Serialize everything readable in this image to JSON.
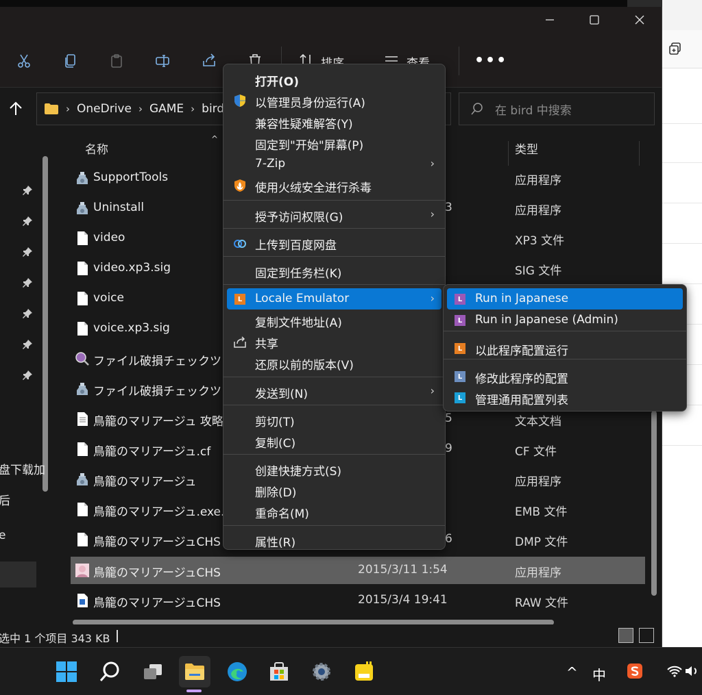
{
  "window": {
    "controls": {
      "minimize": "—",
      "maximize": "□",
      "close": "✕"
    }
  },
  "toolbar": {
    "sort_label": "排序",
    "view_label": "查看",
    "more_label": "•••"
  },
  "address": {
    "segments": [
      "OneDrive",
      "GAME",
      "bird"
    ],
    "search_placeholder": "在 bird 中搜索"
  },
  "columns": {
    "name": "名称",
    "type": "类型"
  },
  "nav": {
    "items": [
      "盘下载加",
      "后",
      "e"
    ]
  },
  "files": [
    {
      "name": "SupportTools",
      "date": "",
      "type": "应用程序",
      "icon": "setup-icon"
    },
    {
      "name": "Uninstall",
      "date": "3",
      "type": "应用程序",
      "icon": "setup-icon"
    },
    {
      "name": "video",
      "date": "",
      "type": "XP3 文件",
      "icon": "file-icon"
    },
    {
      "name": "video.xp3.sig",
      "date": "",
      "type": "SIG 文件",
      "icon": "file-icon"
    },
    {
      "name": "voice",
      "date": "",
      "type": "",
      "icon": "file-icon"
    },
    {
      "name": "voice.xp3.sig",
      "date": "",
      "type": "",
      "icon": "file-icon"
    },
    {
      "name": "ファイル破損チェックツ",
      "date": "",
      "type": "",
      "icon": "magnifier-icon"
    },
    {
      "name": "ファイル破損チェックツ",
      "date": "",
      "type": "",
      "icon": "setup-icon"
    },
    {
      "name": "鳥籠のマリアージュ 攻略",
      "date": "5",
      "type": "文本文档",
      "icon": "text-file-icon"
    },
    {
      "name": "鳥籠のマリアージュ.cf",
      "date": "9",
      "type": "CF 文件",
      "icon": "file-icon"
    },
    {
      "name": "鳥籠のマリアージュ",
      "date": "",
      "type": "应用程序",
      "icon": "setup-icon"
    },
    {
      "name": "鳥籠のマリアージュ.exe.",
      "date": "",
      "type": "EMB 文件",
      "icon": "file-icon"
    },
    {
      "name": "鳥籠のマリアージュCHS",
      "date": "6",
      "type": "DMP 文件",
      "icon": "file-icon"
    },
    {
      "name": "鳥籠のマリアージュCHS",
      "date": "2015/3/11 1:54",
      "type": "应用程序",
      "icon": "app-icon",
      "selected": true
    },
    {
      "name": "鳥籠のマリアージュCHS",
      "date": "2015/3/4 19:41",
      "type": "RAW 文件",
      "icon": "raw-file-icon"
    }
  ],
  "status": {
    "text": "选中 1 个项目  343 KB"
  },
  "context_menu": {
    "groups": [
      [
        {
          "label": "打开(O)",
          "bold": true,
          "icon": ""
        },
        {
          "label": "以管理员身份运行(A)",
          "icon": "uac-shield-icon"
        },
        {
          "label": "兼容性疑难解答(Y)",
          "icon": ""
        },
        {
          "label": "固定到\"开始\"屏幕(P)",
          "icon": ""
        },
        {
          "label": "7-Zip",
          "icon": "",
          "submenu": true
        },
        {
          "label": "使用火绒安全进行杀毒",
          "icon": "huorong-icon"
        }
      ],
      [
        {
          "label": "授予访问权限(G)",
          "icon": "",
          "submenu": true
        }
      ],
      [
        {
          "label": "上传到百度网盘",
          "icon": "baidu-netdisk-icon"
        }
      ],
      [
        {
          "label": "固定到任务栏(K)",
          "icon": ""
        }
      ],
      [
        {
          "label": "Locale Emulator",
          "icon": "locale-emulator-icon",
          "submenu": true,
          "highlighted": true
        },
        {
          "label": "复制文件地址(A)",
          "icon": ""
        },
        {
          "label": "共享",
          "icon": "share-icon"
        },
        {
          "label": "还原以前的版本(V)",
          "icon": ""
        }
      ],
      [
        {
          "label": "发送到(N)",
          "icon": "",
          "submenu": true
        }
      ],
      [
        {
          "label": "剪切(T)",
          "icon": ""
        },
        {
          "label": "复制(C)",
          "icon": ""
        }
      ],
      [
        {
          "label": "创建快捷方式(S)",
          "icon": ""
        },
        {
          "label": "删除(D)",
          "icon": ""
        },
        {
          "label": "重命名(M)",
          "icon": ""
        }
      ],
      [
        {
          "label": "属性(R)",
          "icon": ""
        }
      ]
    ],
    "arrow": "›"
  },
  "submenu": {
    "items": [
      {
        "label": "Run in Japanese",
        "color": "#9b59b6",
        "highlighted": true
      },
      {
        "label": "Run in Japanese (Admin)",
        "color": "#9b59b6"
      },
      {
        "label": "以此程序配置运行",
        "color": "#e67e22"
      },
      {
        "label": "修改此程序的配置",
        "color": "#6c8ebf"
      },
      {
        "label": "管理通用配置列表",
        "color": "#1a9fd6"
      }
    ]
  },
  "taskbar": {
    "tray": {
      "chevron": "^",
      "ime": "中"
    }
  },
  "colors": {
    "highlight": "#0a78d4",
    "menu_bg": "#2c2c2c",
    "window_bg": "#191919"
  }
}
